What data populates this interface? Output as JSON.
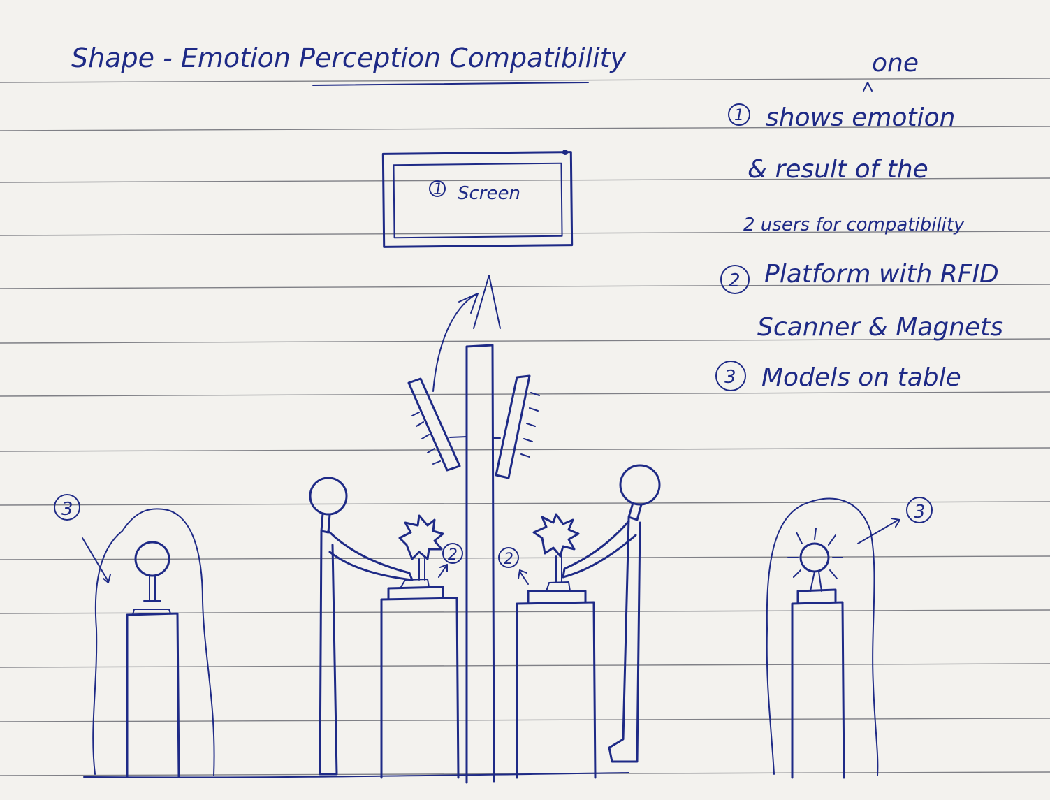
{
  "title": "Shape - Emotion Perception Compatibility",
  "screen_label": "Screen",
  "legend": {
    "insert_word": "one",
    "item1_line1": "shows emotion",
    "item1_line2": "& result of the",
    "item1_line3": "2 users for compatibility",
    "item2_line1": "Platform with RFID",
    "item2_line2": "Scanner & Magnets",
    "item3_line1": "Models on table"
  },
  "markers": {
    "screen": "1",
    "platform_left": "2",
    "platform_right": "2",
    "model_left": "3",
    "model_right": "3",
    "legend_1": "1",
    "legend_2": "2",
    "legend_3": "3"
  },
  "colors": {
    "ink": "#1e2a86",
    "paper": "#f3f2ee",
    "rule_line": "#7f8086"
  }
}
